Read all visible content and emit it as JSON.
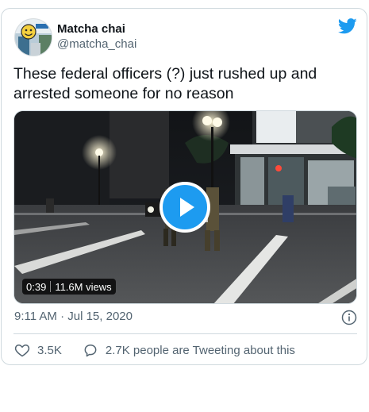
{
  "author": {
    "display_name": "Matcha chai",
    "handle": "@matcha_chai"
  },
  "tweet": {
    "text": "These federal officers (?) just rushed up and arrested someone for no reason",
    "timestamp": "9:11 AM · Jul 15, 2020"
  },
  "media": {
    "duration": "0:39",
    "views": "11.6M views"
  },
  "actions": {
    "likes": "3.5K",
    "replies_label": "2.7K people are Tweeting about this"
  },
  "colors": {
    "accent": "#1d9bf0",
    "text_primary": "#0f1419",
    "text_secondary": "#536471",
    "border": "#cfd9de"
  },
  "icons": [
    "twitter-bird-icon",
    "play-icon",
    "info-icon",
    "heart-icon",
    "speech-bubble-icon"
  ]
}
